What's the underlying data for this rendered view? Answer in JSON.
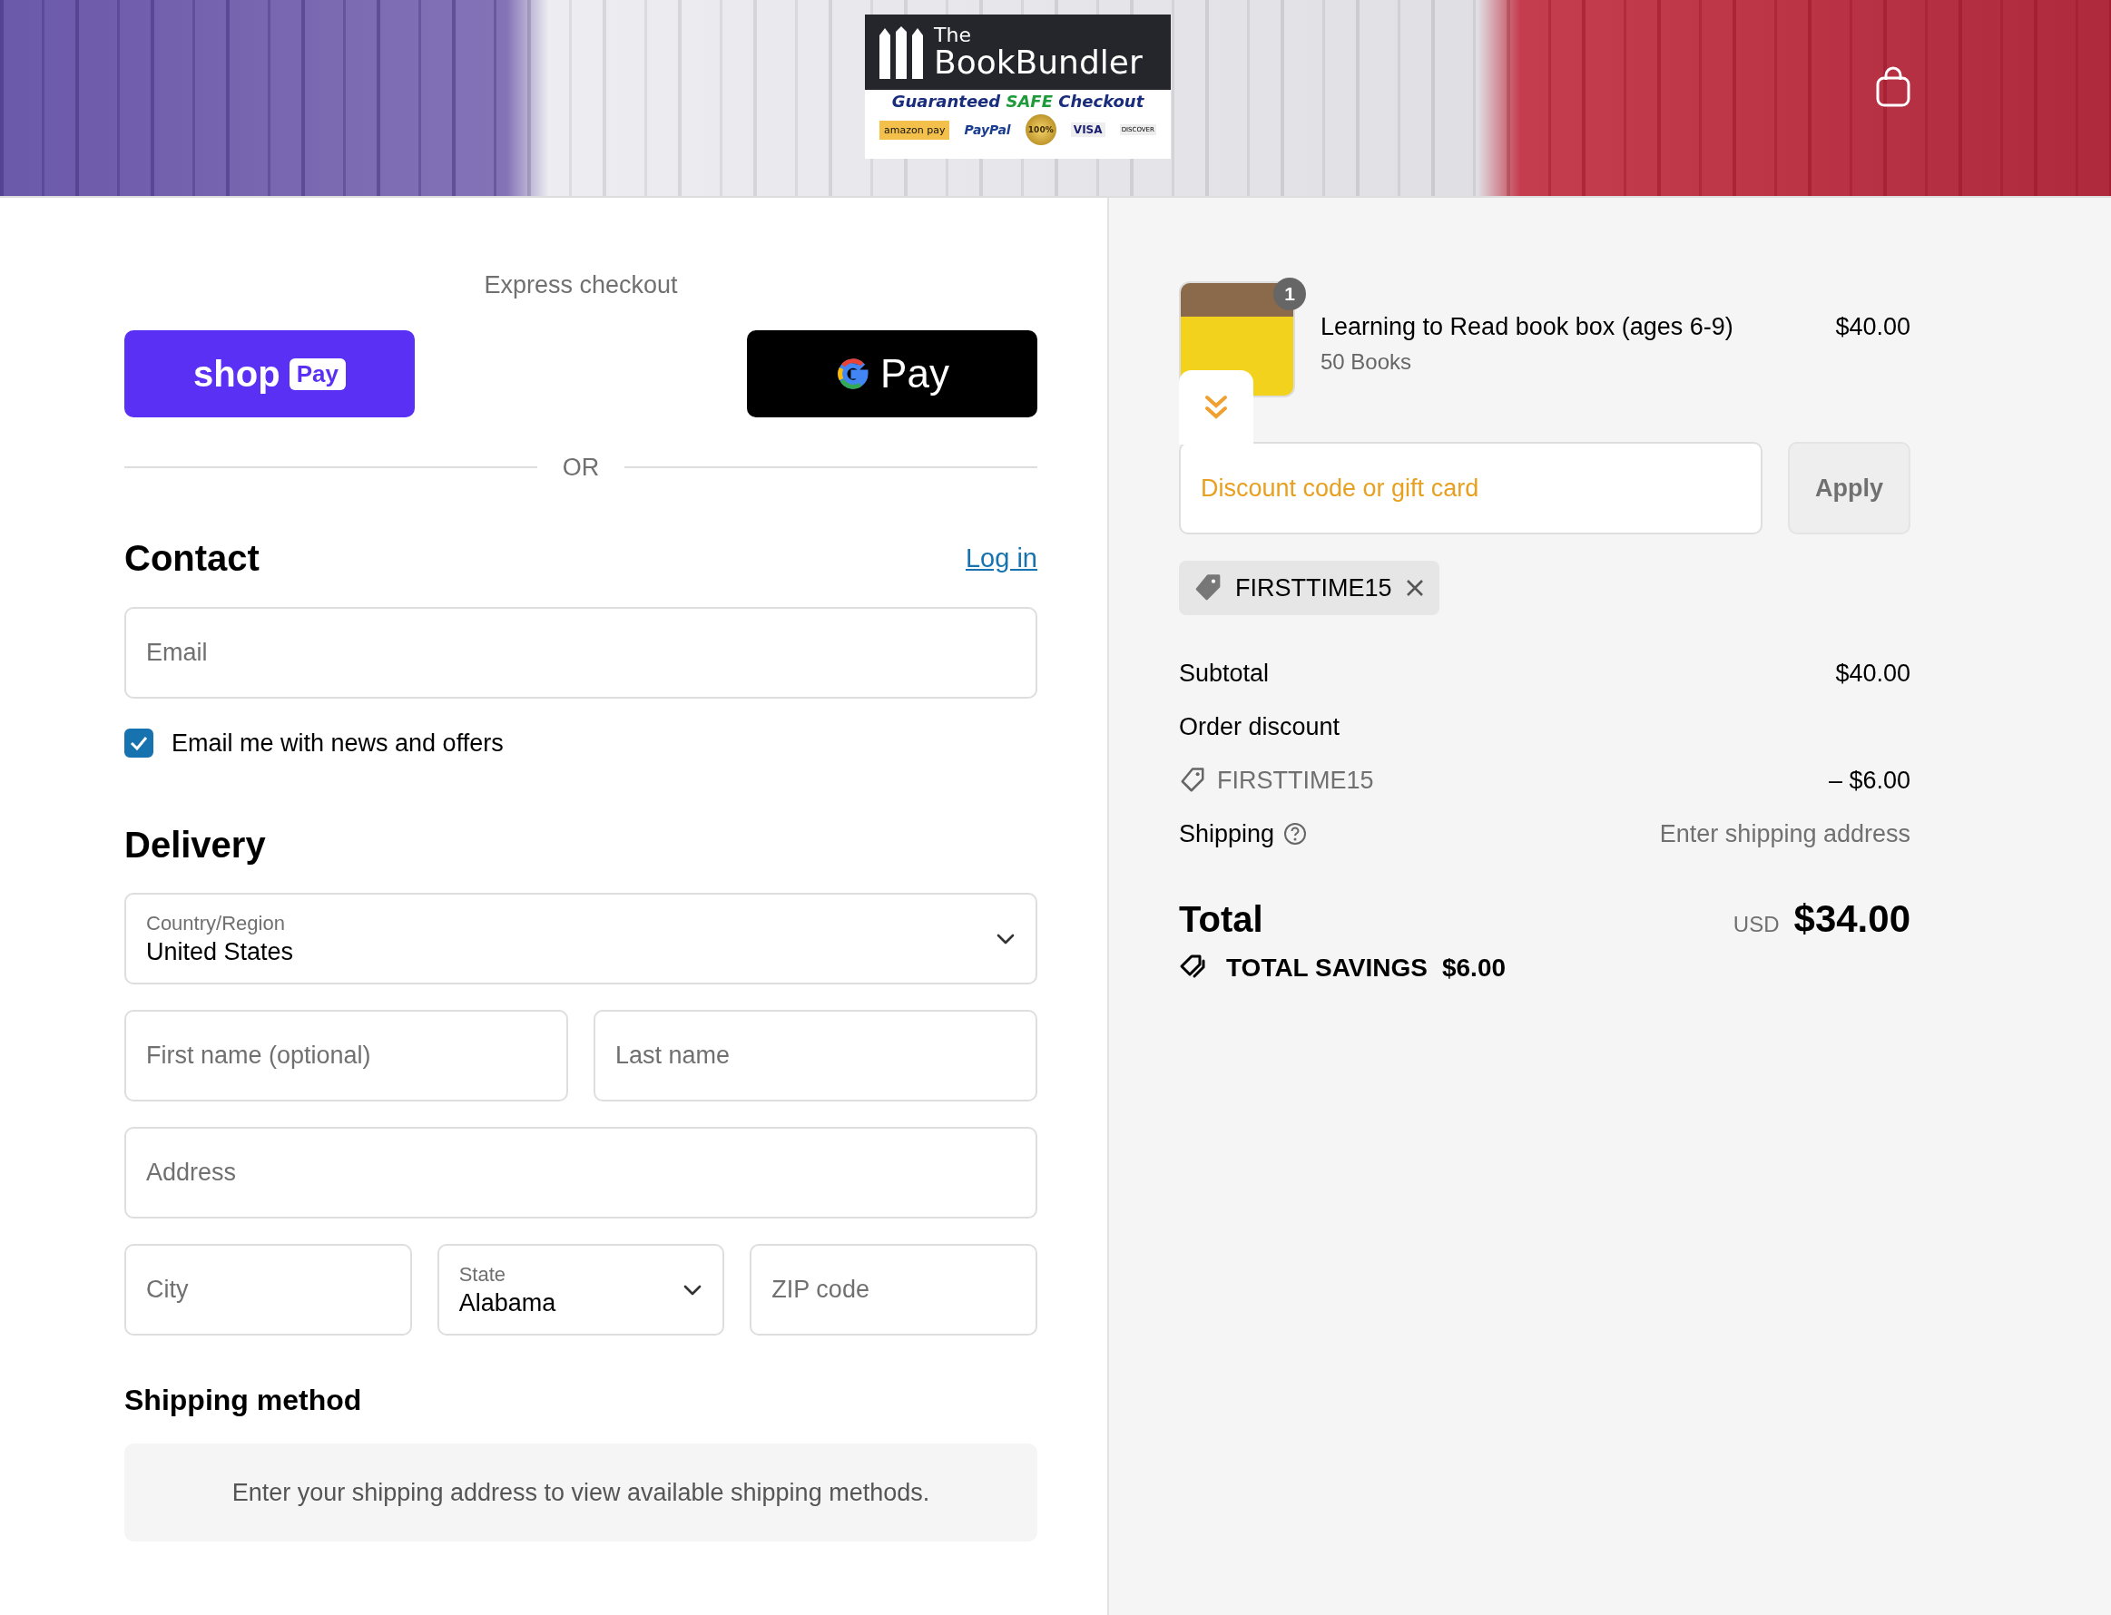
{
  "header": {
    "logo": {
      "line1": "The",
      "line2": "BookBundler",
      "safe": {
        "before": "Guaranteed",
        "highlight": "SAFE",
        "after": "Checkout"
      },
      "badges": [
        "amazon pay",
        "PayPal",
        "100%",
        "VISA",
        "DISCOVER"
      ]
    }
  },
  "express": {
    "title": "Express checkout",
    "buttons": [
      {
        "kind": "shoppay",
        "label": "shop",
        "tag": "Pay"
      },
      {
        "kind": "gpay",
        "label": "Pay"
      }
    ],
    "divider": "OR"
  },
  "contact": {
    "heading": "Contact",
    "login": "Log in",
    "email": {
      "placeholder": "Email"
    },
    "newsletter": {
      "label": "Email me with news and offers",
      "checked": true
    }
  },
  "delivery": {
    "heading": "Delivery",
    "rows": [
      [
        {
          "kind": "select",
          "label": "Country/Region",
          "value": "United States"
        }
      ],
      [
        {
          "kind": "text",
          "placeholder": "First name (optional)"
        },
        {
          "kind": "text",
          "placeholder": "Last name"
        }
      ],
      [
        {
          "kind": "text",
          "placeholder": "Address"
        }
      ],
      [
        {
          "kind": "text",
          "placeholder": "City"
        },
        {
          "kind": "select",
          "label": "State",
          "value": "Alabama"
        },
        {
          "kind": "text",
          "placeholder": "ZIP code"
        }
      ]
    ]
  },
  "shipping_method": {
    "heading": "Shipping method",
    "notice": "Enter your shipping address to view available shipping methods."
  },
  "summary": {
    "item": {
      "title": "Learning to Read book box (ages 6-9)",
      "variant": "50 Books",
      "price": "$40.00",
      "quantity": "1"
    },
    "discount_field": {
      "placeholder": "Discount code or gift card"
    },
    "apply": {
      "label": "Apply",
      "disabled": true
    },
    "applied_code": "FIRSTTIME15",
    "lines": [
      {
        "kind": "amount",
        "label": "Subtotal",
        "value": "$40.00"
      },
      {
        "kind": "heading",
        "label": "Order discount"
      },
      {
        "kind": "code",
        "label": "FIRSTTIME15",
        "value": "– $6.00"
      },
      {
        "kind": "help",
        "label": "Shipping",
        "value": "Enter shipping address"
      }
    ],
    "total": {
      "label": "Total",
      "currency": "USD",
      "amount": "$34.00"
    },
    "savings": {
      "label": "TOTAL SAVINGS",
      "amount": "$6.00"
    }
  }
}
